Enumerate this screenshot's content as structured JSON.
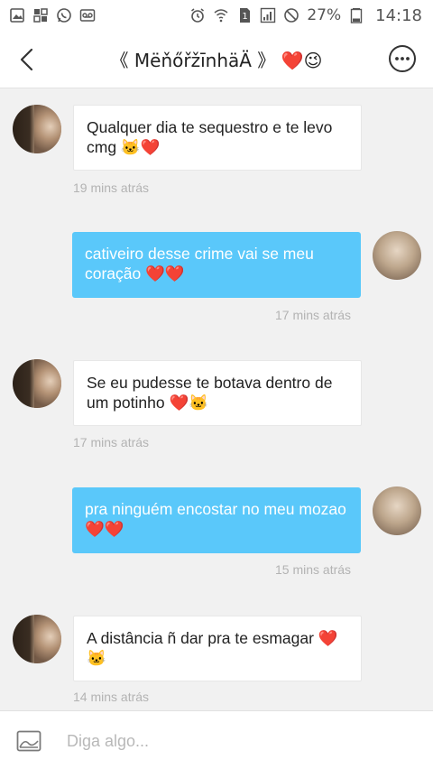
{
  "status_bar": {
    "battery_percent": "27%",
    "time": "14:18",
    "sim_label": "1"
  },
  "header": {
    "title": "《 MëňőřžīnhäÄ 》",
    "title_emojis": "❤️😉"
  },
  "messages": [
    {
      "side": "in",
      "text": "Qualquer dia te sequestro e te levo cmg 🐱❤️",
      "time": "19 mins atrás"
    },
    {
      "side": "out",
      "text": "cativeiro desse crime vai se meu coração ❤️❤️",
      "time": "17 mins atrás"
    },
    {
      "side": "in",
      "text": "Se eu pudesse te botava dentro de um potinho ❤️🐱",
      "time": "17 mins atrás"
    },
    {
      "side": "out",
      "text": "pra ninguém encostar no meu mozao❤️❤️",
      "time": "15 mins atrás"
    },
    {
      "side": "in",
      "text": "A distância ñ dar pra te esmagar ❤️ 🐱",
      "time": "14 mins atrás"
    }
  ],
  "input": {
    "placeholder": "Diga algo..."
  },
  "colors": {
    "outgoing_bubble": "#5ac8fa",
    "incoming_bubble": "#ffffff",
    "background": "#f1f1f1",
    "timestamp": "#b3b3b3"
  }
}
